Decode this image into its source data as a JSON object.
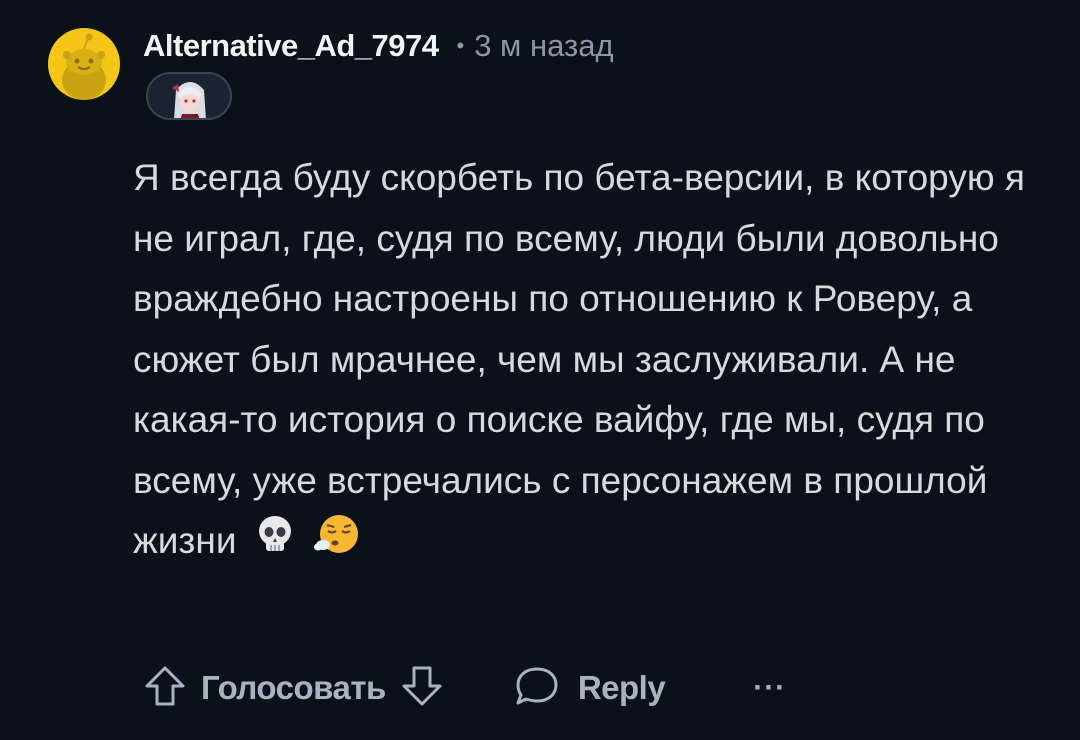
{
  "comment": {
    "username": "Alternative_Ad_7974",
    "separator": "•",
    "timestamp": "3 м назад",
    "text": "Я всегда буду скорбеть по бета-версии, в которую я не играл, где, судя по всему, люди были довольно враждебно настроены по отношению к Роверу, а сюжет был мрачнее, чем мы заслуживали. А не какая-то история о поиске вайфу, где мы, судя по всему, уже встречались с персонажем в прошлой жизни",
    "emojis": [
      "💀",
      "😮‍💨"
    ]
  },
  "actions": {
    "vote_label": "Голосовать",
    "reply_label": "Reply",
    "more_label": "···"
  },
  "icons": {
    "avatar": "snoo-avatar-icon",
    "upvote": "arrow-up-icon",
    "downvote": "arrow-down-icon",
    "reply": "speech-bubble-icon",
    "flair": "anime-character-flair"
  },
  "colors": {
    "background": "#0b1118",
    "avatar_bg": "#f5c518",
    "text": "#d7dadc",
    "muted": "#8b96a6"
  }
}
